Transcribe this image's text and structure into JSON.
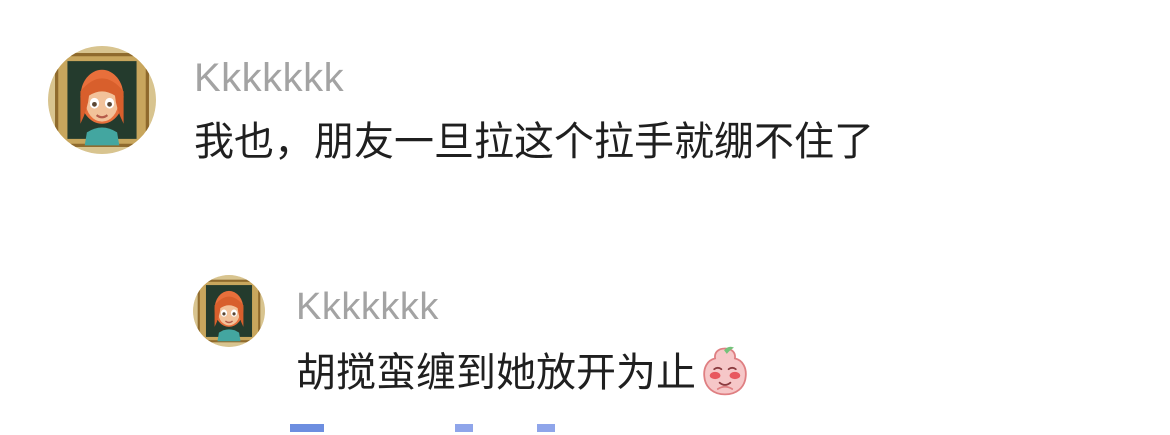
{
  "comments": [
    {
      "username": "Kkkkkkk",
      "text": "我也，朋友一旦拉这个拉手就绷不住了",
      "avatar": "cartoon-girl-avatar"
    },
    {
      "username": "Kkkkkkk",
      "text": "胡搅蛮缠到她放开为止",
      "avatar": "cartoon-girl-avatar",
      "emoji": "blushing-peach-emoji"
    }
  ],
  "colors": {
    "username": "#a3a3a3",
    "text": "#1f1f1f",
    "background": "#ffffff"
  }
}
